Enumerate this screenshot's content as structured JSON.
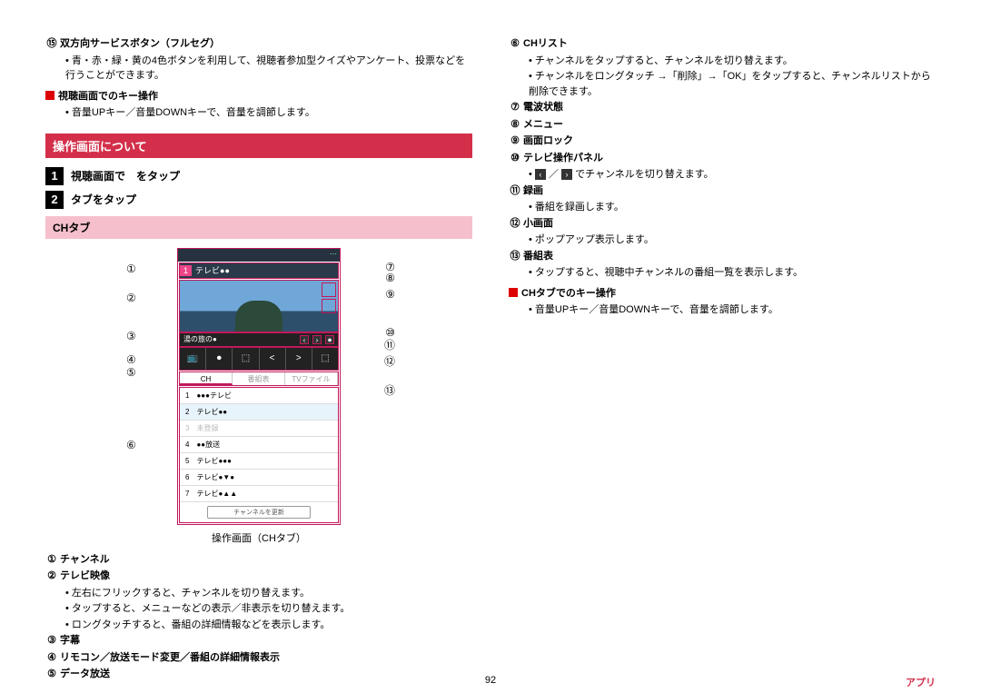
{
  "left": {
    "item15": {
      "num": "⑮",
      "label": "双方向サービスボタン（フルセグ）",
      "desc": "青・赤・緑・黄の4色ボタンを利用して、視聴者参加型クイズやアンケート、投票などを行うことができます。"
    },
    "keyops": {
      "head": "視聴画面でのキー操作",
      "desc": "音量UPキー／音量DOWNキーで、音量を調節します。"
    },
    "section": "操作画面について",
    "step1": {
      "num": "1",
      "text": "視聴画面で　をタップ"
    },
    "step2": {
      "num": "2",
      "text": "タブをタップ"
    },
    "pink": "CHタブ",
    "caption": "操作画面（CHタブ）",
    "diagram_right": {
      "c7": "⑦",
      "c8": "⑧",
      "c9": "⑨",
      "c10": "⑩",
      "c11": "⑪",
      "c12": "⑫",
      "c13": "⑬"
    },
    "diagram_left": {
      "c1": "①",
      "c2": "②",
      "c3": "③",
      "c4": "④",
      "c5": "⑤",
      "c6": "⑥"
    },
    "statusbar_text": "⋯",
    "chbar_badge": "1",
    "chbar_text": "テレビ●●",
    "sub_text": "湯の旅の●",
    "toolbar": [
      "📺",
      "⏺",
      "⬚",
      "<",
      ">",
      "⬚"
    ],
    "tabs": {
      "t1": "CH",
      "t2": "番組表",
      "t3": "TVファイル"
    },
    "chlist": [
      {
        "n": "1",
        "t": "●●●テレビ"
      },
      {
        "n": "2",
        "t": "テレビ●●",
        "sel": true
      },
      {
        "n": "3",
        "t": "未登録",
        "gray": true
      },
      {
        "n": "4",
        "t": "●●放送"
      },
      {
        "n": "5",
        "t": "テレビ●●●"
      },
      {
        "n": "6",
        "t": "テレビ●▼●"
      },
      {
        "n": "7",
        "t": "テレビ●▲▲"
      }
    ],
    "chlist_btn": "チャンネルを更新",
    "items_bottom": {
      "i1": {
        "num": "①",
        "label": "チャンネル"
      },
      "i2": {
        "num": "②",
        "label": "テレビ映像",
        "desc": [
          "左右にフリックすると、チャンネルを切り替えます。",
          "タップすると、メニューなどの表示／非表示を切り替えます。",
          "ロングタッチすると、番組の詳細情報などを表示します。"
        ]
      },
      "i3": {
        "num": "③",
        "label": "字幕"
      },
      "i4": {
        "num": "④",
        "label": "リモコン／放送モード変更／番組の詳細情報表示"
      },
      "i5": {
        "num": "⑤",
        "label": "データ放送"
      }
    }
  },
  "right": {
    "i6": {
      "num": "⑥",
      "label": "CHリスト",
      "desc": [
        "チャンネルをタップすると、チャンネルを切り替えます。",
        "チャンネルをロングタッチ →「削除」→「OK」をタップすると、チャンネルリストから削除できます。"
      ]
    },
    "i7": {
      "num": "⑦",
      "label": "電波状態"
    },
    "i8": {
      "num": "⑧",
      "label": "メニュー"
    },
    "i9": {
      "num": "⑨",
      "label": "画面ロック"
    },
    "i10": {
      "num": "⑩",
      "label": "テレビ操作パネル",
      "desc_plain": " でチャンネルを切り替えます。"
    },
    "i11": {
      "num": "⑪",
      "label": "録画",
      "desc": [
        "番組を録画します。"
      ]
    },
    "i12": {
      "num": "⑫",
      "label": "小画面",
      "desc": [
        "ポップアップ表示します。"
      ]
    },
    "i13": {
      "num": "⑬",
      "label": "番組表",
      "desc": [
        "タップすると、視聴中チャンネルの番組一覧を表示します。"
      ]
    },
    "keyops": {
      "head": "CHタブでのキー操作",
      "desc": "音量UPキー／音量DOWNキーで、音量を調節します。"
    }
  },
  "footer": {
    "page": "92",
    "cat": "アプリ"
  }
}
